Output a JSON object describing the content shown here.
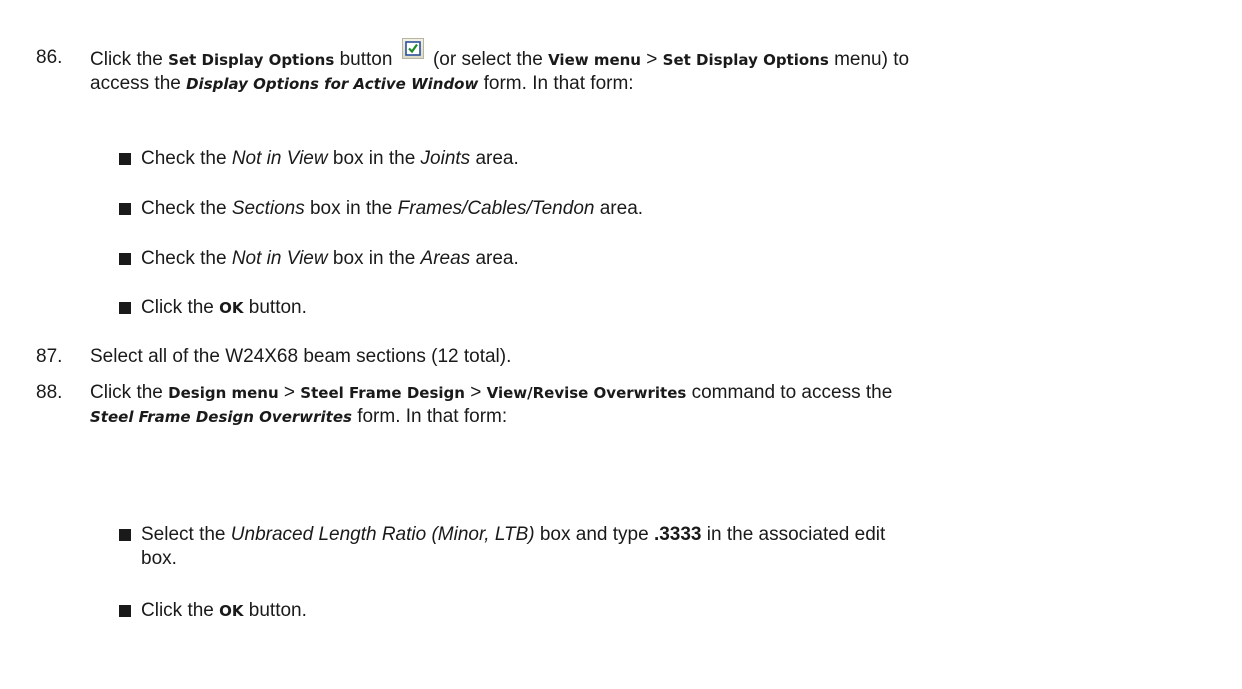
{
  "step86": {
    "num": "86.",
    "t1": "Click the ",
    "cmd1": "Set Display Options",
    "t2": " button ",
    "t3": " (or select the ",
    "cmd2": "View menu",
    "t4": " > ",
    "cmd3": "Set Display Options",
    "t5": " menu) to",
    "t6": "access the ",
    "form": "Display Options for Active Window",
    "t7": " form. In that form:",
    "bullets": [
      {
        "a": "Check the ",
        "i1": "Not in View",
        "b": " box in the ",
        "i2": "Joints",
        "c": " area."
      },
      {
        "a": "Check the ",
        "i1": "Sections",
        "b": " box in the ",
        "i2": "Frames/Cables/Tendon",
        "c": " area."
      },
      {
        "a": "Check the ",
        "i1": "Not in View",
        "b": " box in the ",
        "i2": "Areas",
        "c": " area."
      },
      {
        "a": "Click the ",
        "cmd": "OK",
        "c": " button."
      }
    ]
  },
  "step87": {
    "num": "87.",
    "text": "Select all of the W24X68 beam sections (12 total)."
  },
  "step88": {
    "num": "88.",
    "t1": "Click the ",
    "cmd1": "Design menu",
    "sep1": " > ",
    "cmd2": "Steel Frame Design",
    "sep2": " > ",
    "cmd3": "View/Revise Overwrites",
    "t2": " command to access the",
    "form": "Steel Frame Design Overwrites",
    "t3": " form. In that form:",
    "bullets": [
      {
        "a": "Select the ",
        "i1": "Unbraced Length Ratio (Minor, LTB)",
        "b": " box and type ",
        "val": ".3333",
        "c": " in the associated edit",
        "d": "box."
      },
      {
        "a": "Click the ",
        "cmd": "OK",
        "c": " button."
      }
    ]
  }
}
